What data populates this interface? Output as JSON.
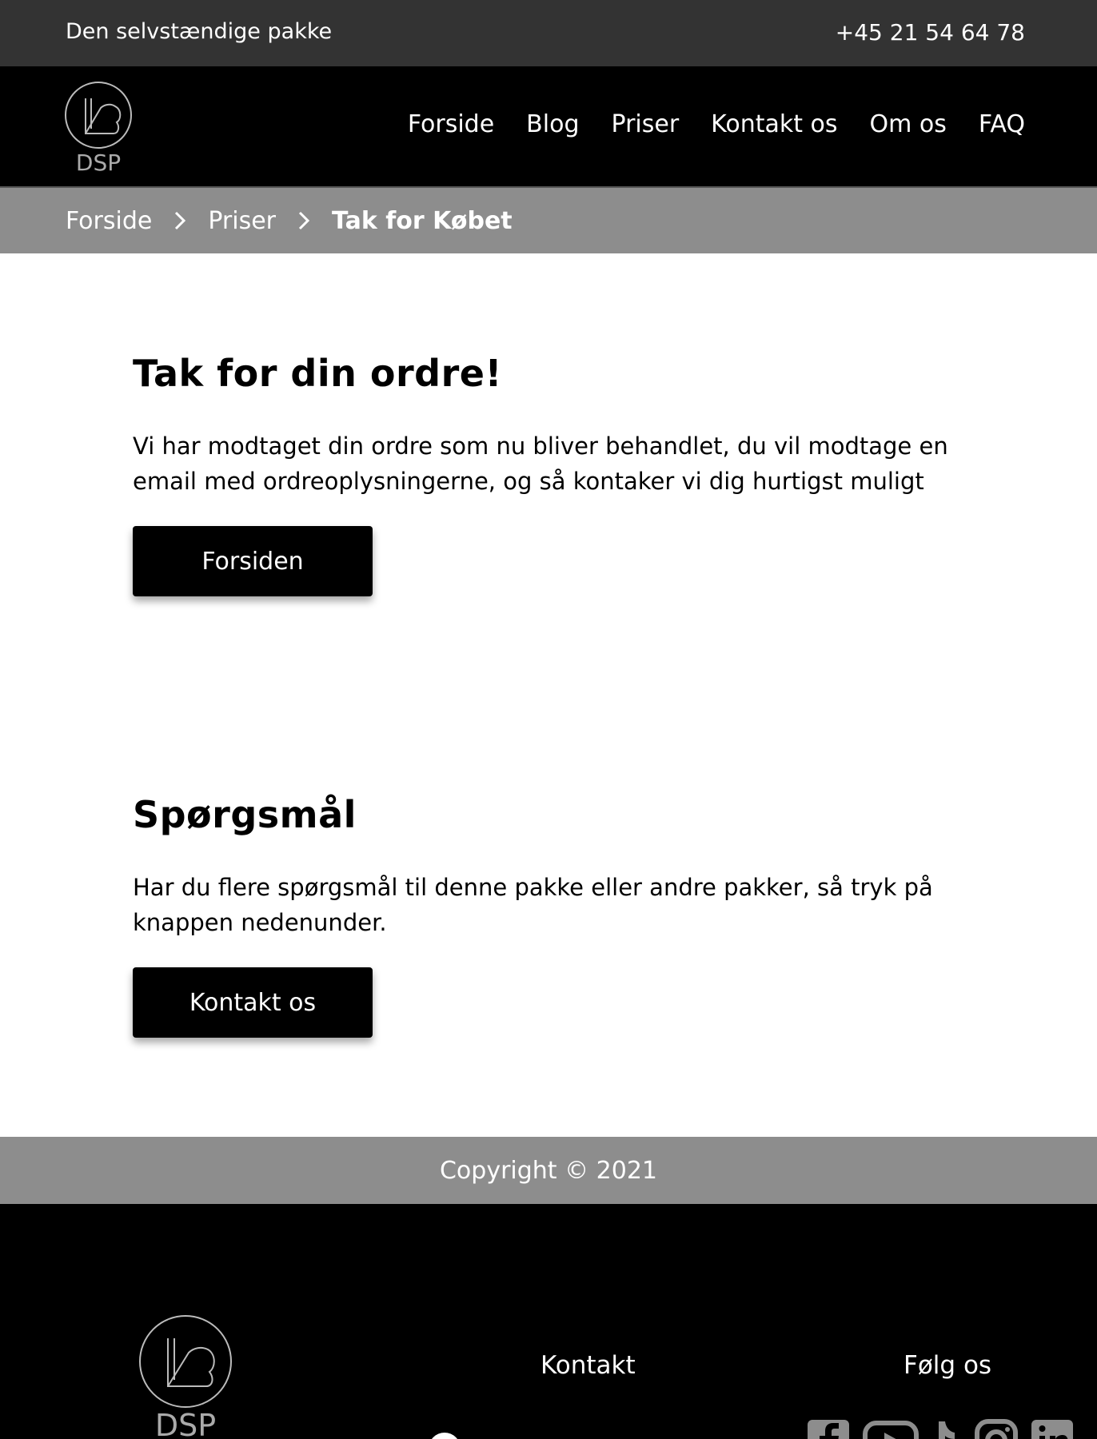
{
  "topbar": {
    "package_name": "Den selvstændige pakke",
    "phone": "+45 21 54 64 78"
  },
  "brand": {
    "logo_text": "DSP"
  },
  "nav": {
    "items": [
      "Forside",
      "Blog",
      "Priser",
      "Kontakt os",
      "Om os",
      "FAQ"
    ]
  },
  "breadcrumb": {
    "items": [
      "Forside",
      "Priser"
    ],
    "current": "Tak for Købet"
  },
  "thanks": {
    "title": "Tak for din ordre!",
    "body": "Vi har modtaget din ordre som nu bliver behandlet, du vil modtage en email med ordreoplysningerne, og så kontaker vi dig hurtigst muligt",
    "button_label": "Forsiden"
  },
  "questions": {
    "title": "Spørgsmål",
    "body": "Har du flere spørgsmål til denne pakke eller andre pakker, så tryk på knappen nedenunder.",
    "button_label": "Kontakt os"
  },
  "copyright": "Copyright © 2021",
  "footer": {
    "contact_title": "Kontakt",
    "follow_title": "Følg os",
    "social_icons": [
      "facebook-icon",
      "youtube-icon",
      "tiktok-icon",
      "instagram-icon",
      "linkedin-icon"
    ]
  },
  "colors": {
    "topbar_bg": "#333333",
    "nav_bg": "#000000",
    "breadcrumb_bg": "#8d8d8d",
    "button_bg": "#000000",
    "social_icon": "#8d8d8d"
  }
}
